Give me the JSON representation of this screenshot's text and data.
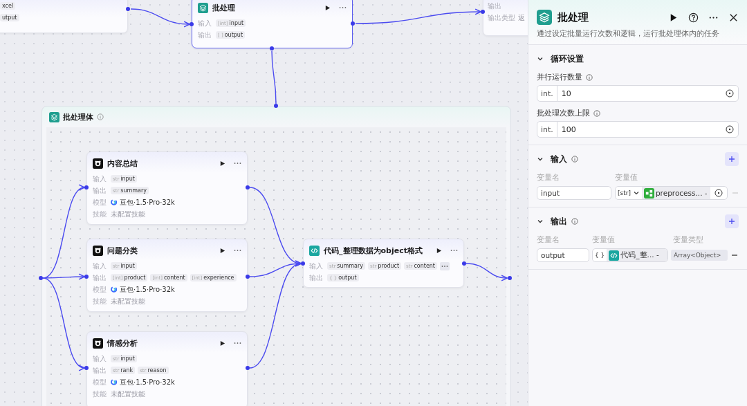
{
  "canvas": {
    "top_nodes": [
      {
        "kind": "partial",
        "rows": [
          {
            "kind": "ports",
            "tags": [
              {
                "name": "xcel"
              }
            ]
          },
          {
            "kind": "ports",
            "tags": [
              {
                "name": "utput"
              }
            ]
          }
        ]
      },
      {
        "kind": "batch",
        "title": "批处理",
        "rows": [
          {
            "kind": "ports",
            "label": "输入",
            "tags": [
              {
                "type": "[int]",
                "name": "input"
              }
            ]
          },
          {
            "kind": "ports",
            "label": "输出",
            "tags": [
              {
                "type": "[ ]",
                "name": "output"
              }
            ]
          }
        ]
      },
      {
        "kind": "partial",
        "rows": [
          {
            "kind": "text",
            "label": "输出"
          },
          {
            "kind": "text",
            "label": "输出类型",
            "text": "返"
          }
        ]
      }
    ],
    "batch_body": {
      "title": "批处理体",
      "nodes": [
        {
          "kind": "llm",
          "title": "内容总结",
          "rows": [
            {
              "kind": "ports",
              "label": "输入",
              "tags": [
                {
                  "type": "str",
                  "name": "input"
                }
              ]
            },
            {
              "kind": "ports",
              "label": "输出",
              "tags": [
                {
                  "type": "str",
                  "name": "summary"
                }
              ]
            },
            {
              "kind": "model",
              "label": "模型",
              "text": "豆包·1.5·Pro·32k"
            },
            {
              "kind": "text",
              "label": "技能",
              "text": "未配置技能"
            }
          ]
        },
        {
          "kind": "llm",
          "title": "问题分类",
          "rows": [
            {
              "kind": "ports",
              "label": "输入",
              "tags": [
                {
                  "type": "str",
                  "name": "input"
                }
              ]
            },
            {
              "kind": "ports",
              "label": "输出",
              "tags": [
                {
                  "type": "[int]",
                  "name": "product"
                },
                {
                  "type": "[int]",
                  "name": "content"
                },
                {
                  "type": "[int]",
                  "name": "experience"
                }
              ]
            },
            {
              "kind": "model",
              "label": "模型",
              "text": "豆包·1.5·Pro·32k"
            },
            {
              "kind": "text",
              "label": "技能",
              "text": "未配置技能"
            }
          ]
        },
        {
          "kind": "llm",
          "title": "情感分析",
          "rows": [
            {
              "kind": "ports",
              "label": "输入",
              "tags": [
                {
                  "type": "str",
                  "name": "input"
                }
              ]
            },
            {
              "kind": "ports",
              "label": "输出",
              "tags": [
                {
                  "type": "str",
                  "name": "rank"
                },
                {
                  "type": "str",
                  "name": "reason"
                }
              ]
            },
            {
              "kind": "model",
              "label": "模型",
              "text": "豆包·1.5·Pro·32k"
            },
            {
              "kind": "text",
              "label": "技能",
              "text": "未配置技能"
            }
          ]
        },
        {
          "kind": "code",
          "title": "代码_整理数据为object格式",
          "rows": [
            {
              "kind": "ports",
              "label": "输入",
              "overflow": true,
              "tags": [
                {
                  "type": "str",
                  "name": "summary"
                },
                {
                  "type": "str",
                  "name": "product"
                },
                {
                  "type": "str",
                  "name": "content"
                }
              ]
            },
            {
              "kind": "ports",
              "label": "输出",
              "tags": [
                {
                  "type": "{ }",
                  "name": "output"
                }
              ]
            }
          ]
        }
      ]
    }
  },
  "panel": {
    "title": "批处理",
    "description": "通过设定批量运行次数和逻辑，运行批处理体内的任务",
    "sections": [
      {
        "kind": "settings",
        "title": "循环设置",
        "expanded": true,
        "fields": [
          {
            "label": "并行运行数量",
            "prefix": "int.",
            "value": "10"
          },
          {
            "label": "批处理次数上限",
            "prefix": "int.",
            "value": "100"
          }
        ]
      },
      {
        "kind": "variables",
        "title": "输入",
        "expanded": true,
        "columns": [
          "变量名",
          "变量值"
        ],
        "rows": [
          {
            "name": "input",
            "type": "[str]",
            "kind": "workflow",
            "source": "preprocess...",
            "suffix": "-",
            "removable": false
          }
        ]
      },
      {
        "kind": "variables",
        "title": "输出",
        "expanded": true,
        "columns": [
          "变量名",
          "变量值",
          "变量类型"
        ],
        "rows": [
          {
            "name": "output",
            "type": "{ }",
            "kind": "code",
            "source": "代码_整...",
            "suffix": "-",
            "var_type": "Array<Object>",
            "removable": true
          }
        ]
      }
    ]
  }
}
